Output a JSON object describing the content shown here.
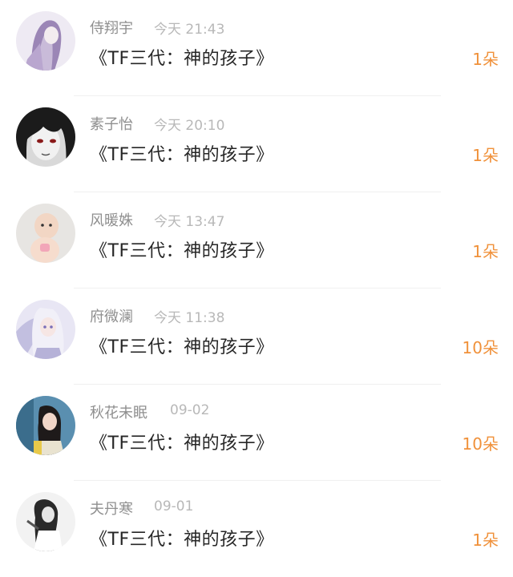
{
  "colors": {
    "name": "#8f8f8f",
    "time": "#b8b8b8",
    "title": "#262626",
    "count_accent": "#f0913a",
    "divider": "#f0f0f0"
  },
  "items": [
    {
      "name": "侍翔宇",
      "time": "今天 21:43",
      "title": "《TF三代：神的孩子》",
      "count": "1朵",
      "avatar": "purple-hair-girl-avatar"
    },
    {
      "name": "素子怡",
      "time": "今天 20:10",
      "title": "《TF三代：神的孩子》",
      "count": "1朵",
      "avatar": "anime-boy-avatar"
    },
    {
      "name": "风暖姝",
      "time": "今天 13:47",
      "title": "《TF三代：神的孩子》",
      "count": "1朵",
      "avatar": "baby-avatar"
    },
    {
      "name": "府微澜",
      "time": "今天 11:38",
      "title": "《TF三代：神的孩子》",
      "count": "10朵",
      "avatar": "anime-girl-umbrella-avatar"
    },
    {
      "name": "秋花未眠",
      "time": "09-02",
      "title": "《TF三代：神的孩子》",
      "count": "10朵",
      "avatar": "girl-photo-avatar"
    },
    {
      "name": "夫丹寒",
      "time": "09-01",
      "title": "《TF三代：神的孩子》",
      "count": "1朵",
      "avatar": "bw-girl-avatar"
    }
  ]
}
